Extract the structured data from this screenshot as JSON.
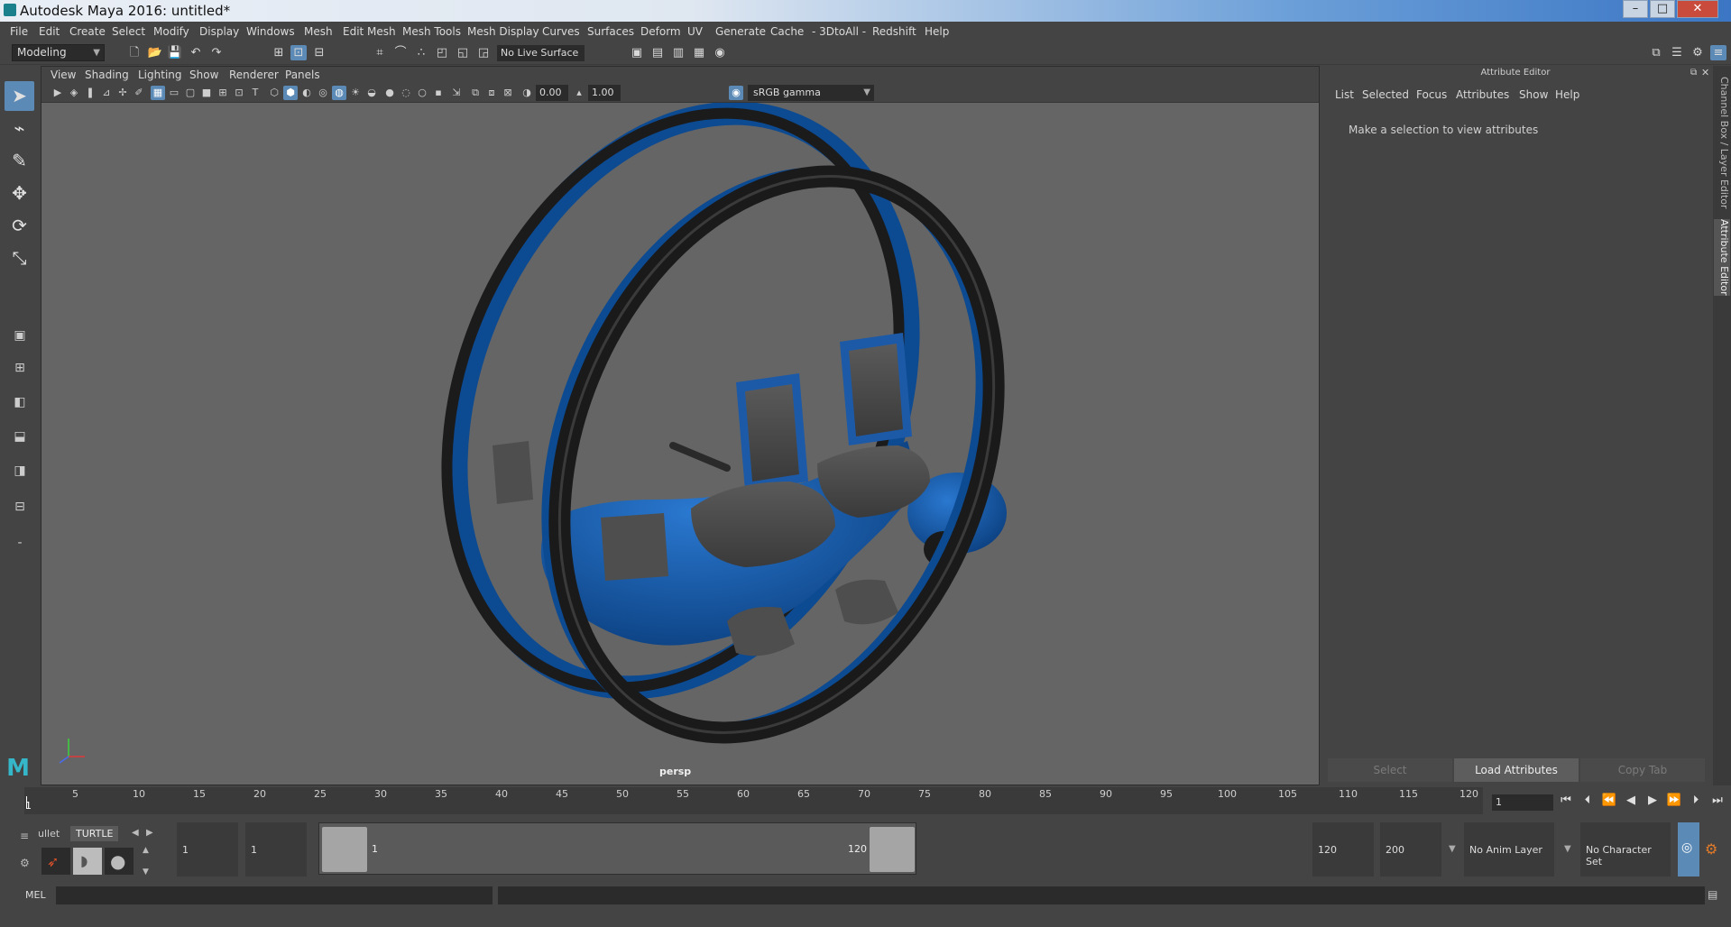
{
  "window": {
    "title": "Autodesk Maya 2016: untitled*",
    "controls": [
      "–",
      "□",
      "✕"
    ]
  },
  "menubar": {
    "items": [
      "File",
      "Edit",
      "Create",
      "Select",
      "Modify",
      "Display",
      "Windows",
      "Mesh",
      "Edit Mesh",
      "Mesh Tools",
      "Mesh Display",
      "Curves",
      "Surfaces",
      "Deform",
      "UV",
      "Generate",
      "Cache",
      "- 3DtoAll -",
      "Redshift",
      "Help"
    ]
  },
  "status_line": {
    "mode": "Modeling",
    "live_surface": "No Live Surface"
  },
  "viewport": {
    "menu": [
      "View",
      "Shading",
      "Lighting",
      "Show",
      "Renderer",
      "Panels"
    ],
    "exposure": "0.00",
    "gamma": "1.00",
    "color_space": "sRGB gamma",
    "camera_label": "persp"
  },
  "attribute_editor": {
    "title": "Attribute Editor",
    "menu": [
      "List",
      "Selected",
      "Focus",
      "Attributes",
      "Show",
      "Help"
    ],
    "message": "Make a selection to view attributes",
    "buttons": {
      "select": "Select",
      "load": "Load Attributes",
      "copy_tab": "Copy Tab"
    },
    "side_tabs": [
      "Channel Box / Layer Editor",
      "Attribute Editor"
    ]
  },
  "time_slider": {
    "ticks": [
      "5",
      "10",
      "15",
      "20",
      "25",
      "30",
      "35",
      "40",
      "45",
      "50",
      "55",
      "60",
      "65",
      "70",
      "75",
      "80",
      "85",
      "90",
      "95",
      "100",
      "105",
      "110",
      "115",
      "120"
    ],
    "current_marker": "1",
    "current_frame": "1"
  },
  "range_slider": {
    "start_time": "1",
    "playback_start": "1",
    "range_start_label": "1",
    "range_end_label": "120",
    "playback_end": "120",
    "end_time": "200",
    "anim_layer": "No Anim Layer",
    "character_set": "No Character Set",
    "shelf_tabs": [
      "ullet",
      "TURTLE"
    ]
  },
  "command_line": {
    "label": "MEL"
  },
  "colors": {
    "accent_blue": "#5c8ab6",
    "model_blue": "#0d4f9c",
    "viewport_bg": "#656565"
  }
}
